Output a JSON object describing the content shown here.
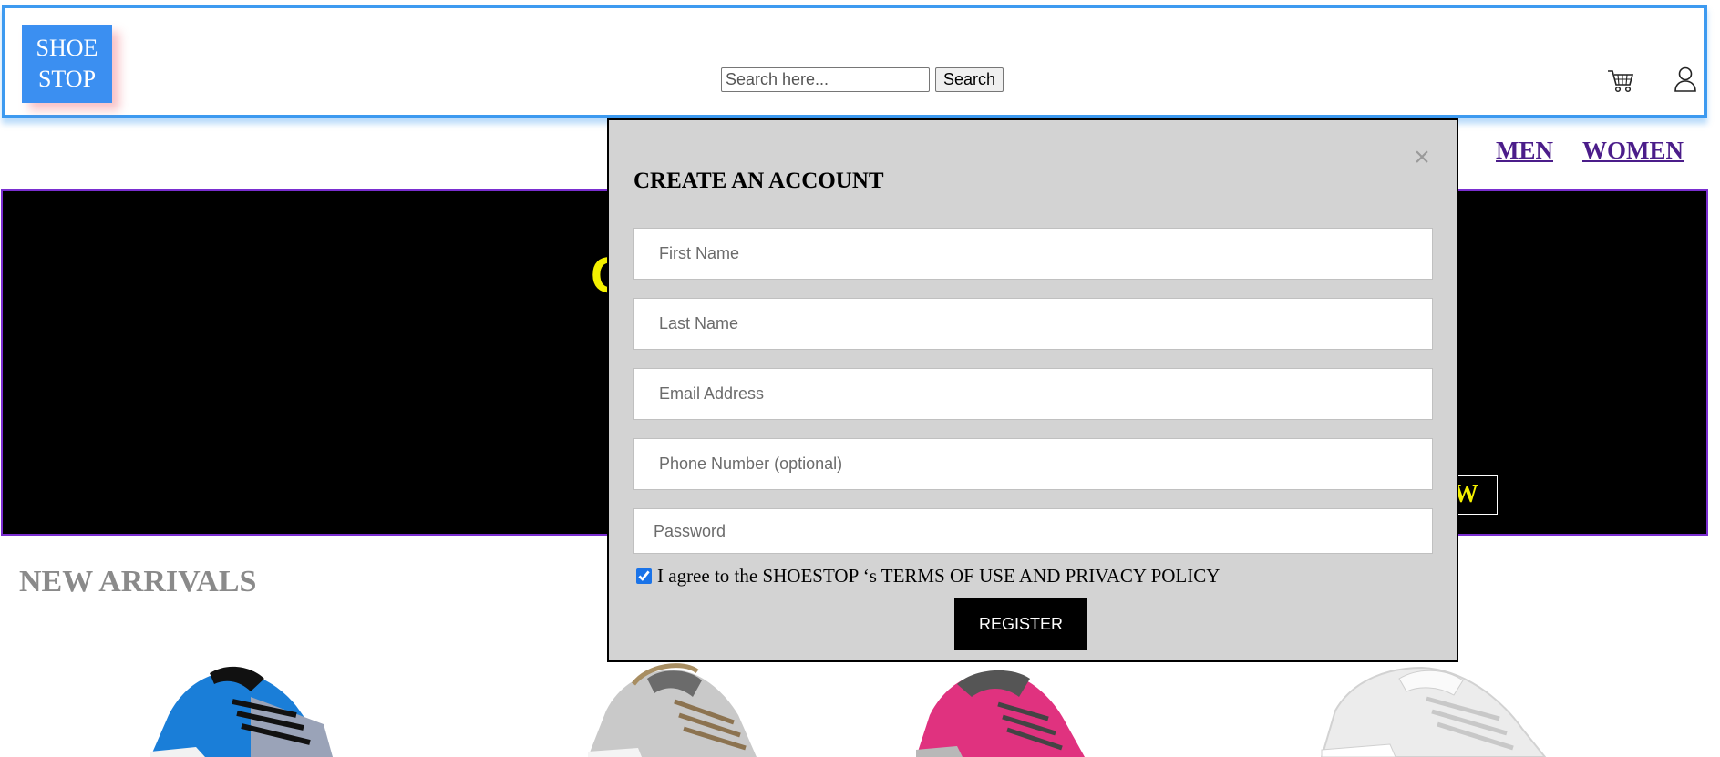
{
  "header": {
    "logo_line1": "SHOE",
    "logo_line2": "STOP",
    "search_placeholder": "Search here...",
    "search_button": "Search",
    "icons": [
      "cart-icon",
      "user-icon"
    ]
  },
  "nav": {
    "men": "MEN",
    "women": "WOMEN"
  },
  "hero": {
    "heading_partial": "C",
    "button_partial": "OW"
  },
  "new_arrivals": {
    "title": "NEW ARRIVALS",
    "items": [
      "blue-sneaker",
      "gray-casual-shoe",
      "pink-running-shoe",
      "white-sneaker"
    ]
  },
  "modal": {
    "title": "CREATE AN ACCOUNT",
    "close": "×",
    "fields": {
      "first_name": "First Name",
      "last_name": "Last Name",
      "email": "Email Address",
      "phone": "Phone Number (optional)",
      "password": "Password"
    },
    "agree_text": "I agree to the SHOESTOP ‘s TERMS OF USE AND PRIVACY POLICY",
    "agree_checked": true,
    "register": "REGISTER"
  },
  "colors": {
    "header_border": "#3d9af0",
    "logo_bg": "#3b8ff1",
    "nav_link": "#4b1d8a",
    "hero_bg": "#000000",
    "hero_accent": "#f4f000",
    "modal_bg": "#d3d3d3"
  }
}
